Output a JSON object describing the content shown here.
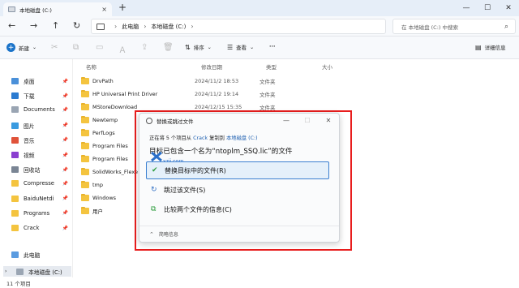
{
  "tab": {
    "title": "本地磁盘 (C:)",
    "close": "×",
    "new": "+"
  },
  "window": {
    "minimize": "—",
    "maximize": "☐",
    "close": "✕"
  },
  "address": {
    "crumbs": [
      "此电脑",
      "本地磁盘 (C:)"
    ],
    "sep": "›",
    "search_placeholder": "在 本地磁盘 (C:) 中搜索"
  },
  "toolbar": {
    "new_label": "新建",
    "sort_label": "排序",
    "view_label": "查看",
    "more_label": "···",
    "details_label": "详细信息"
  },
  "sidebar": {
    "items": [
      {
        "label": "桌面",
        "color": "#4a90d9",
        "pin": true
      },
      {
        "label": "下载",
        "color": "#2b7bd1",
        "pin": true
      },
      {
        "label": "Documents",
        "color": "#9aa5b3",
        "pin": true
      },
      {
        "label": "图片",
        "color": "#3a9be0",
        "pin": true
      },
      {
        "label": "音乐",
        "color": "#e0533a",
        "pin": true
      },
      {
        "label": "视频",
        "color": "#8b3fd0",
        "pin": true
      },
      {
        "label": "回收站",
        "color": "#7a8594",
        "pin": true
      },
      {
        "label": "Compresse",
        "color": "#f4c43f",
        "pin": true
      },
      {
        "label": "BaiduNetdi",
        "color": "#f4c43f",
        "pin": true
      },
      {
        "label": "Programs",
        "color": "#f4c43f",
        "pin": true
      },
      {
        "label": "Crack",
        "color": "#f4c43f",
        "pin": true
      }
    ],
    "this_pc": "此电脑",
    "drive": "本地磁盘 (C:)"
  },
  "columns": {
    "name": "名称",
    "date": "修改日期",
    "type": "类型",
    "size": "大小"
  },
  "files": [
    {
      "name": "DrvPath",
      "date": "2024/11/2 18:53",
      "type": "文件夹"
    },
    {
      "name": "HP Universal Print Driver",
      "date": "2024/11/2 19:14",
      "type": "文件夹"
    },
    {
      "name": "MStoreDownload",
      "date": "2024/12/15 15:35",
      "type": "文件夹"
    },
    {
      "name": "Newtemp",
      "date": "",
      "type": ""
    },
    {
      "name": "PerfLogs",
      "date": "",
      "type": ""
    },
    {
      "name": "Program Files",
      "date": "",
      "type": ""
    },
    {
      "name": "Program Files",
      "date": "",
      "type": ""
    },
    {
      "name": "SolidWorks_Flexe",
      "date": "",
      "type": ""
    },
    {
      "name": "tmp",
      "date": "",
      "type": ""
    },
    {
      "name": "Windows",
      "date": "",
      "type": ""
    },
    {
      "name": "用户",
      "date": "",
      "type": ""
    }
  ],
  "status": "11 个项目",
  "dialog": {
    "title": "替换或跳过文件",
    "line_prefix": "正在将 5 个项目从",
    "from": "Crack",
    "line_mid": "复制到",
    "to": "本地磁盘 (C:)",
    "main": "目标已包含一个名为“ntoplm_SSQ.lic”的文件",
    "options": [
      {
        "icon": "✔",
        "label": "替换目标中的文件(R)",
        "selected": true,
        "icon_color": "#2e9e3e"
      },
      {
        "icon": "↻",
        "label": "跳过该文件(S)",
        "selected": false,
        "icon_color": "#2a6bc2"
      },
      {
        "icon": "⧉",
        "label": "比较两个文件的信息(C)",
        "selected": false,
        "icon_color": "#2e9e3e"
      }
    ],
    "footer": "简略信息",
    "watermark": "xzji.com",
    "colors": {
      "accent": "#3b7fd0",
      "highlight": "#e81d1d"
    }
  }
}
